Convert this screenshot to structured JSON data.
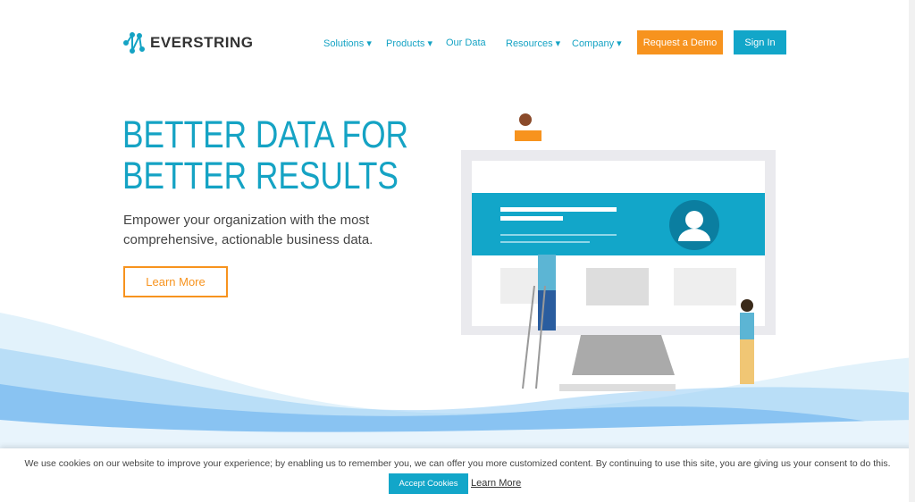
{
  "brand": {
    "name": "EVERSTRING",
    "color": "#15a3c4",
    "accent": "#f7931e"
  },
  "nav": {
    "items": [
      {
        "label": "Solutions",
        "dropdown": true
      },
      {
        "label": "Products",
        "dropdown": true
      },
      {
        "label": "Our Data",
        "dropdown": false
      },
      {
        "label": "Resources",
        "dropdown": true
      },
      {
        "label": "Company",
        "dropdown": true
      }
    ],
    "demo_label": "Request a Demo",
    "signin_label": "Sign In"
  },
  "hero": {
    "title_line1": "BETTER DATA FOR",
    "title_line2": "BETTER RESULTS",
    "subtitle": "Empower your organization with the most comprehensive, actionable business data.",
    "cta_label": "Learn More"
  },
  "cookie": {
    "text": "We use cookies on our website to improve your experience; by enabling us to remember you, we can offer you more customized content. By continuing to use this site, you are giving us your consent to do this.",
    "accept_label": "Accept Cookies",
    "learn_label": "Learn More"
  }
}
